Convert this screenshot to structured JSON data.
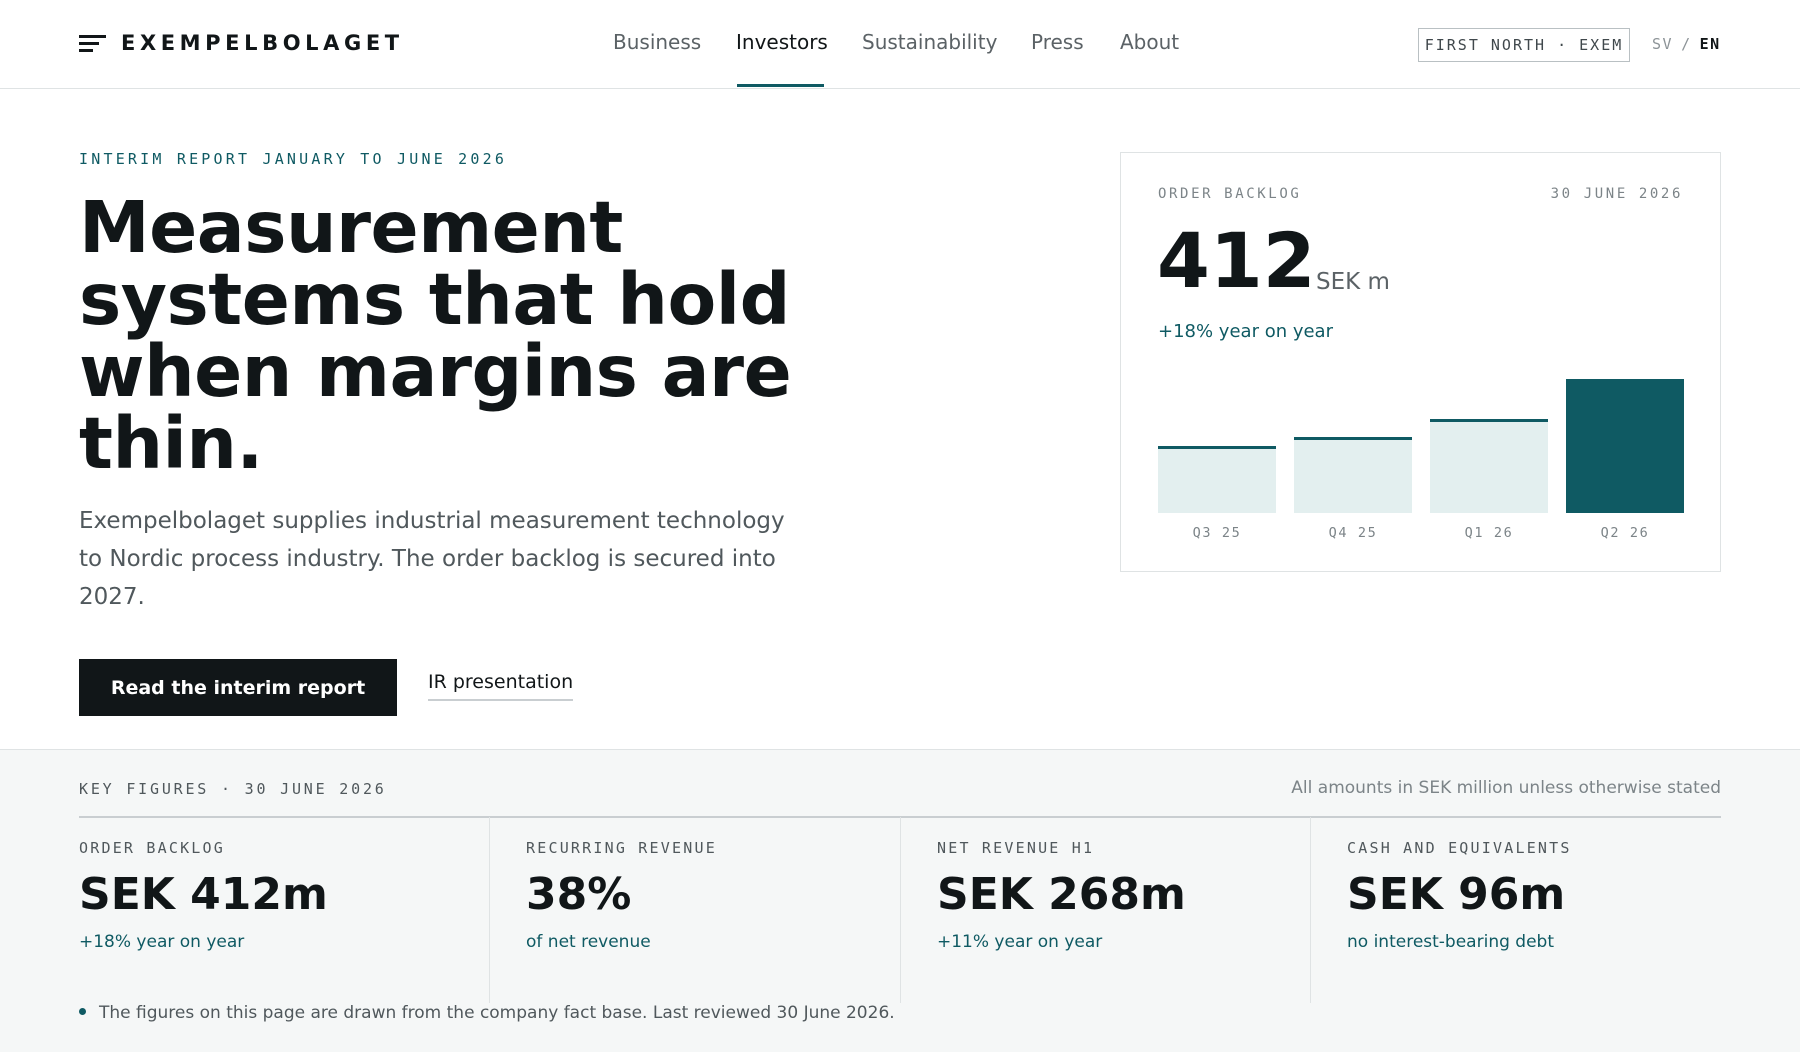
{
  "header": {
    "logo": "EXEMPELBOLAGET",
    "nav": [
      "Business",
      "Investors",
      "Sustainability",
      "Press",
      "About"
    ],
    "active_nav": "Investors",
    "ticker": "FIRST NORTH · EXEM",
    "lang": {
      "sv": "SV",
      "separator": "/",
      "en": "EN",
      "active": "EN"
    }
  },
  "hero": {
    "eyebrow": "INTERIM REPORT JANUARY TO JUNE 2026",
    "title": "Measurement systems that hold when margins are thin.",
    "lede": "Exempelbolaget supplies industrial measurement technology to Nordic process industry. The order backlog is secured into 2027.",
    "primary_cta": "Read the interim report",
    "secondary_cta": "IR presentation"
  },
  "backlog_card": {
    "label": "ORDER BACKLOG",
    "date": "30 JUNE 2026",
    "value": "412",
    "unit": "SEK m",
    "change": "+18% year on year"
  },
  "chart_data": {
    "type": "bar",
    "categories": [
      "Q3 25",
      "Q4 25",
      "Q1 26",
      "Q2 26"
    ],
    "values": [
      275,
      295,
      330,
      412
    ],
    "ylim": [
      140,
      412
    ],
    "highlight_index": 3,
    "grid": false
  },
  "key_figures": {
    "label": "KEY FIGURES · 30 JUNE 2026",
    "note": "All amounts in SEK million unless otherwise stated",
    "items": [
      {
        "label": "ORDER BACKLOG",
        "value": "SEK 412m",
        "sub": "+18% year on year"
      },
      {
        "label": "RECURRING REVENUE",
        "value": "38%",
        "sub": "of net revenue"
      },
      {
        "label": "NET REVENUE H1",
        "value": "SEK 268m",
        "sub": "+11% year on year"
      },
      {
        "label": "CASH AND EQUIVALENTS",
        "value": "SEK 96m",
        "sub": "no interest-bearing debt"
      }
    ],
    "footnote": "The figures on this page are drawn from the company fact base. Last reviewed 30 June 2026."
  },
  "colors": {
    "accent": "#0f5a63",
    "text": "#111618",
    "bar_light": "#e3efef",
    "panel": "#f5f7f7"
  }
}
